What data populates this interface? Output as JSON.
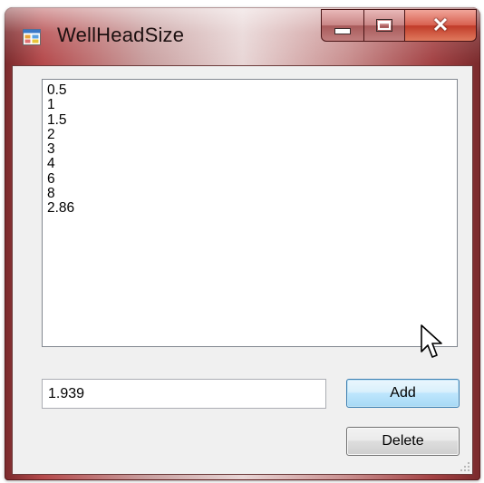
{
  "window": {
    "title": "WellHeadSize",
    "accent_color": "#b54a4c"
  },
  "icons": {
    "app": "app-window-icon",
    "minimize": "minimize-icon",
    "maximize": "maximize-icon",
    "close": "close-icon",
    "cursor": "mouse-pointer-icon",
    "grip": "resize-grip-icon"
  },
  "list": {
    "items": [
      "0.5",
      "1",
      "1.5",
      "2",
      "3",
      "4",
      "6",
      "8",
      "2.86"
    ]
  },
  "input": {
    "value": "1.939"
  },
  "buttons": {
    "add_label": "Add",
    "delete_label": "Delete"
  }
}
